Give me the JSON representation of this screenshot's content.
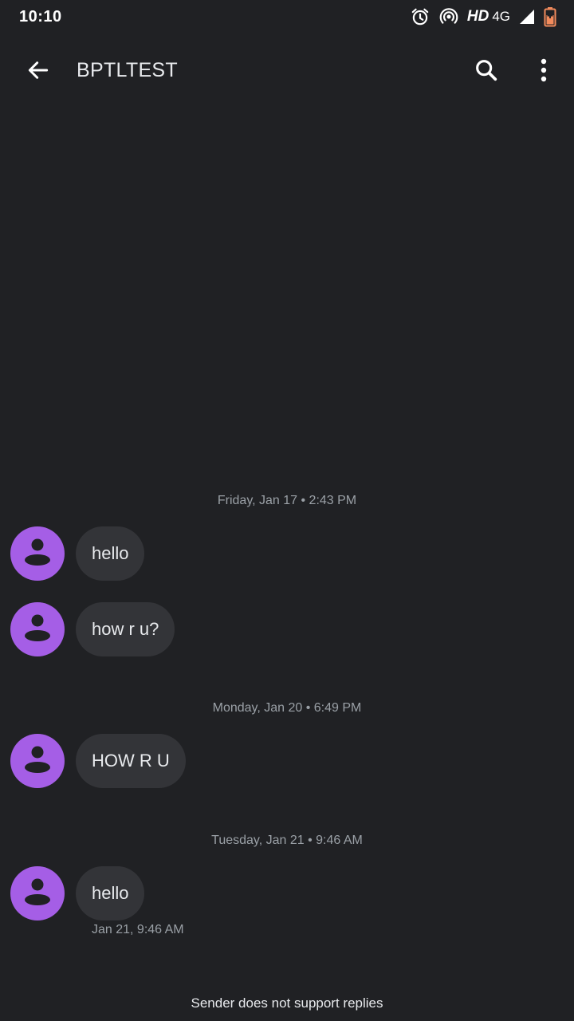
{
  "status_bar": {
    "time": "10:10",
    "hd": "HD",
    "network": "4G",
    "icons": [
      "alarm-icon",
      "hotspot-icon",
      "signal-icon",
      "battery-icon"
    ]
  },
  "app_bar": {
    "title": "BPTLTEST",
    "icons": [
      "back-arrow-icon",
      "search-icon",
      "more-vert-icon"
    ]
  },
  "conversation": {
    "groups": [
      {
        "timestamp": "Friday, Jan 17 • 2:43 PM",
        "messages": [
          {
            "text": "hello"
          },
          {
            "text": "how r u?"
          }
        ]
      },
      {
        "timestamp": "Monday, Jan 20 • 6:49 PM",
        "messages": [
          {
            "text": "HOW R U"
          }
        ]
      },
      {
        "timestamp": "Tuesday, Jan 21 • 9:46 AM",
        "messages": [
          {
            "text": "hello",
            "time": "Jan 21, 9:46 AM"
          }
        ]
      }
    ]
  },
  "footer": {
    "note": "Sender does not support replies"
  },
  "colors": {
    "background": "#202124",
    "bubble": "#333438",
    "avatar": "#a55ee6",
    "secondary_text": "#9aa0a6"
  }
}
